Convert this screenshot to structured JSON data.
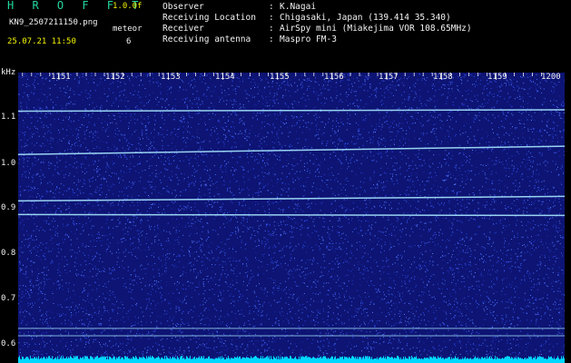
{
  "header": {
    "app_title": "H R O F F T",
    "version": "1.0.0f",
    "filename": "KN9_2507211150.png",
    "meteor_label": "meteor",
    "datetime": "25.07.21 11:50",
    "meteor_count": "6",
    "meta": [
      {
        "key": "Observer",
        "value": "K.Nagai"
      },
      {
        "key": "Receiving Location",
        "value": "Chigasaki, Japan (139.414 35.340)"
      },
      {
        "key": "Receiver",
        "value": "AirSpy mini (Miakejima VOR 108.65MHz)"
      },
      {
        "key": "Receiving antenna",
        "value": "Maspro FM-3"
      }
    ],
    "separator": ":"
  },
  "axis": {
    "y_unit": "kHz",
    "y_ticks": [
      "1.1",
      "1.0",
      "0.9",
      "0.8",
      "0.7",
      "0.6"
    ],
    "x_ticks": [
      "1151",
      "1152",
      "1153",
      "1154",
      "1155",
      "1156",
      "1157",
      "1158",
      "1159",
      "1200"
    ]
  },
  "colors": {
    "background": "#0d1473",
    "noise": "#3a56ff",
    "trace": "#a8e8ff",
    "floor": "#00d8ff",
    "header_yellow": "#f2f200",
    "header_white": "#f2f2f2",
    "title_green": "#22d8a0"
  },
  "chart_data": {
    "type": "heatmap",
    "y_unit": "kHz",
    "y_ticks": [
      1.1,
      1.0,
      0.9,
      0.8,
      0.7,
      0.6
    ],
    "x_ticks": [
      "1151",
      "1152",
      "1153",
      "1154",
      "1155",
      "1156",
      "1157",
      "1158",
      "1159",
      "1200"
    ],
    "traces": [
      {
        "freq_khz_start": 1.105,
        "freq_khz_end": 1.108
      },
      {
        "freq_khz_start": 1.01,
        "freq_khz_end": 1.028
      },
      {
        "freq_khz_start": 0.908,
        "freq_khz_end": 0.918
      },
      {
        "freq_khz_start": 0.878,
        "freq_khz_end": 0.876
      },
      {
        "freq_khz_start": 0.628,
        "freq_khz_end": 0.628
      },
      {
        "freq_khz_start": 0.612,
        "freq_khz_end": 0.612
      }
    ]
  }
}
